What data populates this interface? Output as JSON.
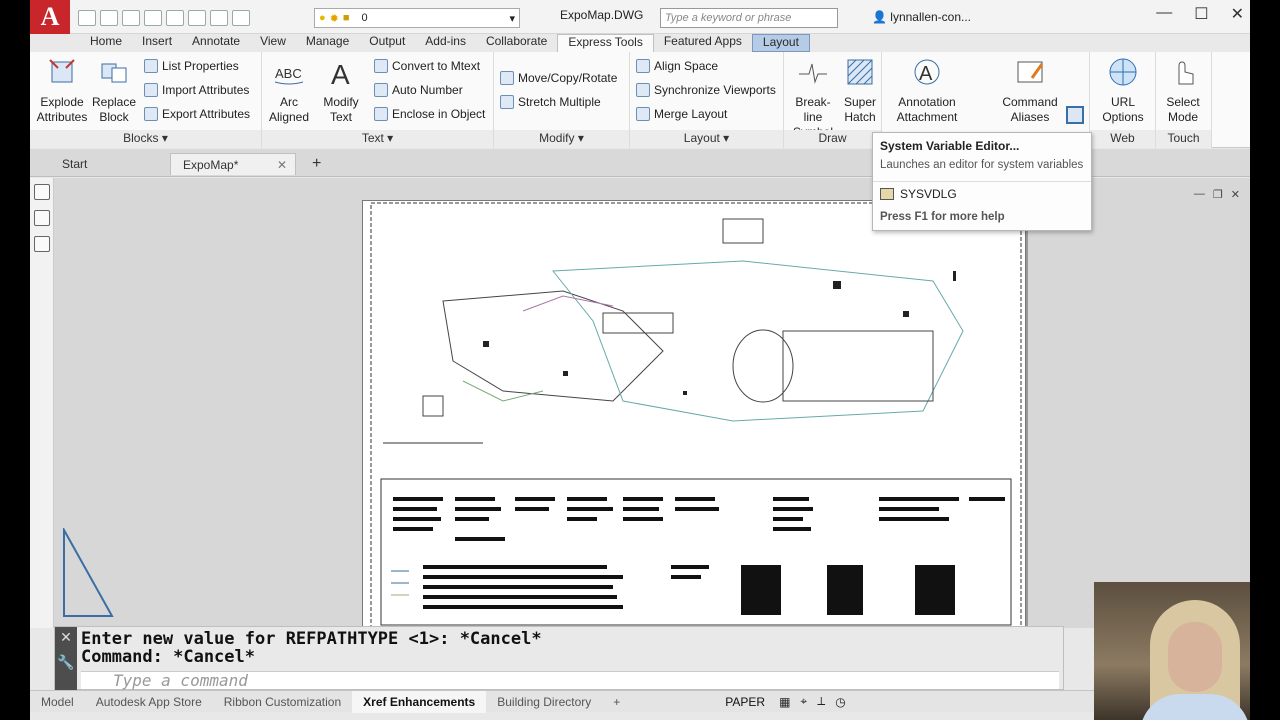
{
  "app": {
    "logo_letter": "A",
    "doc_title": "ExpoMap.DWG",
    "layer_value": "0",
    "search_placeholder": "Type a keyword or phrase",
    "user": "lynnallen-con..."
  },
  "ribbon_tabs": [
    "Home",
    "Insert",
    "Annotate",
    "View",
    "Manage",
    "Output",
    "Add-ins",
    "Collaborate",
    "Express Tools",
    "Featured Apps",
    "Layout"
  ],
  "ribbon": {
    "blocks": {
      "title": "Blocks",
      "explode_line1": "Explode",
      "explode_line2": "Attributes",
      "replace_line1": "Replace",
      "replace_line2": "Block",
      "list_properties": "List Properties",
      "import_attributes": "Import Attributes",
      "export_attributes": "Export Attributes"
    },
    "text": {
      "title": "Text",
      "arc_line1": "Arc",
      "arc_line2": "Aligned",
      "modify_line1": "Modify",
      "modify_line2": "Text",
      "convert_mtext": "Convert to Mtext",
      "auto_number": "Auto Number",
      "enclose": "Enclose in Object"
    },
    "modify": {
      "title": "Modify",
      "move_copy_rotate": "Move/Copy/Rotate",
      "stretch_multiple": "Stretch Multiple"
    },
    "layout": {
      "title": "Layout",
      "align_space": "Align Space",
      "sync_viewports": "Synchronize Viewports",
      "merge_layout": "Merge Layout"
    },
    "draw": {
      "title": "Draw",
      "breakline_line1": "Break-line",
      "breakline_line2": "Symbol",
      "superhatch_line1": "Super",
      "superhatch_line2": "Hatch"
    },
    "tools": {
      "annotation_line1": "Annotation",
      "annotation_line2": "Attachment",
      "command_line1": "Command",
      "command_line2": "Aliases"
    },
    "web": {
      "title": "Web",
      "url_line1": "URL",
      "url_line2": "Options"
    },
    "touch": {
      "title": "Touch",
      "select_line1": "Select",
      "select_line2": "Mode"
    }
  },
  "file_tabs": {
    "start": "Start",
    "active": "ExpoMap*"
  },
  "tooltip": {
    "title": "System Variable Editor...",
    "description": "Launches an editor for system variables",
    "command": "SYSVDLG",
    "help": "Press F1 for more help"
  },
  "command_line": {
    "line1": "Enter new value for REFPATHTYPE <1>: *Cancel*",
    "line2": "Command: *Cancel*",
    "placeholder": "Type a command"
  },
  "status": {
    "layout_tabs": [
      "Model",
      "Autodesk App Store",
      "Ribbon Customization",
      "Xref Enhancements",
      "Building Directory"
    ],
    "active_tab": "Xref Enhancements",
    "paper": "PAPER"
  },
  "colors": {
    "accent_logo": "#c8262a",
    "active_tab_bg": "#b5cbe6"
  }
}
